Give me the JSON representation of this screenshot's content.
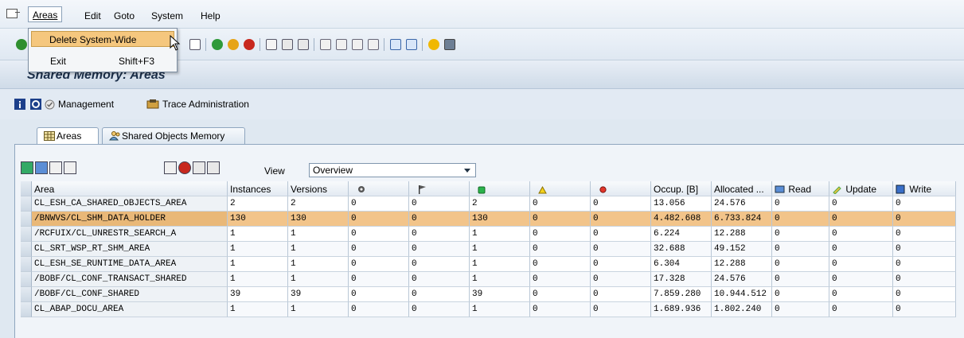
{
  "menubar": {
    "items": [
      {
        "label": "Areas",
        "underline": "A",
        "active": true
      },
      {
        "label": "Edit",
        "underline": "E"
      },
      {
        "label": "Goto",
        "underline": "G"
      },
      {
        "label": "System",
        "underline": "y"
      },
      {
        "label": "Help",
        "underline": "H"
      }
    ]
  },
  "dropdown": {
    "items": [
      {
        "label": "Delete System-Wide",
        "shortcut": "",
        "highlighted": true
      },
      {
        "label": "Exit",
        "shortcut": "Shift+F3",
        "highlighted": false
      }
    ]
  },
  "title": "Shared Memory: Areas",
  "app_toolbar": {
    "management": "Management",
    "trace": "Trace Administration"
  },
  "tabs": [
    {
      "label": "Areas",
      "active": true
    },
    {
      "label": "Shared Objects Memory",
      "active": false
    }
  ],
  "view": {
    "label": "View",
    "selected": "Overview"
  },
  "grid": {
    "columns": [
      "Area",
      "Instances",
      "Versions",
      "",
      "",
      "",
      "",
      "",
      "Occup. [B]",
      "Allocated ...",
      "Read",
      "Update",
      "Write"
    ],
    "rows": [
      [
        "CL_ESH_CA_SHARED_OBJECTS_AREA",
        "2",
        "2",
        "0",
        "0",
        "2",
        "0",
        "0",
        "13.056",
        "24.576",
        "0",
        "0",
        "0"
      ],
      [
        "/BNWVS/CL_SHM_DATA_HOLDER",
        "130",
        "130",
        "0",
        "0",
        "130",
        "0",
        "0",
        "4.482.608",
        "6.733.824",
        "0",
        "0",
        "0"
      ],
      [
        "/RCFUIX/CL_UNRESTR_SEARCH_A",
        "1",
        "1",
        "0",
        "0",
        "1",
        "0",
        "0",
        "6.224",
        "12.288",
        "0",
        "0",
        "0"
      ],
      [
        "CL_SRT_WSP_RT_SHM_AREA",
        "1",
        "1",
        "0",
        "0",
        "1",
        "0",
        "0",
        "32.688",
        "49.152",
        "0",
        "0",
        "0"
      ],
      [
        "CL_ESH_SE_RUNTIME_DATA_AREA",
        "1",
        "1",
        "0",
        "0",
        "1",
        "0",
        "0",
        "6.304",
        "12.288",
        "0",
        "0",
        "0"
      ],
      [
        "/BOBF/CL_CONF_TRANSACT_SHARED",
        "1",
        "1",
        "0",
        "0",
        "1",
        "0",
        "0",
        "17.328",
        "24.576",
        "0",
        "0",
        "0"
      ],
      [
        "/BOBF/CL_CONF_SHARED",
        "39",
        "39",
        "0",
        "0",
        "39",
        "0",
        "0",
        "7.859.280",
        "10.944.512",
        "0",
        "0",
        "0"
      ],
      [
        "CL_ABAP_DOCU_AREA",
        "1",
        "1",
        "0",
        "0",
        "1",
        "0",
        "0",
        "1.689.936",
        "1.802.240",
        "0",
        "0",
        "0"
      ]
    ],
    "selected_row": 1
  },
  "colors": {
    "selected_row": "#f2c48a",
    "menu_highlight": "#f5c77e"
  }
}
